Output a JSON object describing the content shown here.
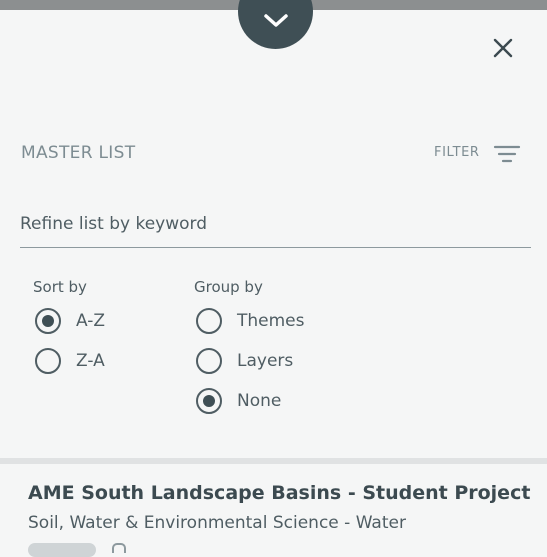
{
  "panel": {
    "title": "MASTER LIST",
    "filter_label": "FILTER",
    "icons": {
      "collapse": "chevron-down-icon",
      "close": "close-icon",
      "filter": "filter-lines-icon"
    }
  },
  "search": {
    "placeholder": "Refine list by keyword",
    "value": ""
  },
  "sort": {
    "title": "Sort by",
    "options": [
      {
        "label": "A-Z",
        "selected": true
      },
      {
        "label": "Z-A",
        "selected": false
      }
    ]
  },
  "group": {
    "title": "Group by",
    "options": [
      {
        "label": "Themes",
        "selected": false
      },
      {
        "label": "Layers",
        "selected": false
      },
      {
        "label": "None",
        "selected": true
      }
    ]
  },
  "list": {
    "items": [
      {
        "title": "AME South Landscape Basins - Student Project",
        "subtitle": "Soil, Water & Environmental Science - Water"
      }
    ]
  },
  "colors": {
    "background": "#f5f6f6",
    "accent": "#3f4f55",
    "muted_text": "#7d8c92"
  }
}
